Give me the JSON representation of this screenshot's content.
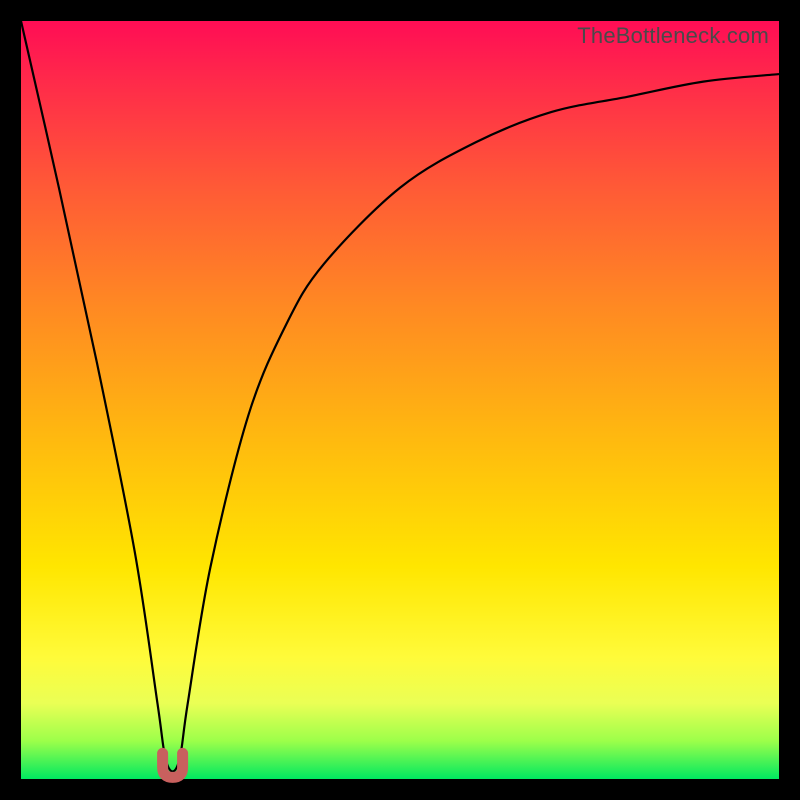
{
  "watermark": "TheBottleneck.com",
  "colors": {
    "background": "#000000",
    "gradient_top": "#ff0d55",
    "gradient_mid1": "#ff8a22",
    "gradient_mid2": "#ffe600",
    "gradient_bottom": "#00e860",
    "curve": "#000000",
    "dip_marker": "#c8605e"
  },
  "chart_data": {
    "type": "line",
    "title": "",
    "xlabel": "",
    "ylabel": "",
    "xlim": [
      0,
      100
    ],
    "ylim": [
      0,
      100
    ],
    "series": [
      {
        "name": "bottleneck-curve",
        "x": [
          0,
          5,
          10,
          15,
          18,
          19,
          20,
          21,
          22,
          25,
          30,
          35,
          40,
          50,
          60,
          70,
          80,
          90,
          100
        ],
        "y": [
          100,
          78,
          55,
          30,
          10,
          3,
          1,
          3,
          10,
          28,
          48,
          60,
          68,
          78,
          84,
          88,
          90,
          92,
          93
        ]
      }
    ],
    "annotations": [
      {
        "name": "dip-marker",
        "x": 20,
        "y": 1,
        "shape": "u"
      }
    ],
    "grid": false,
    "legend": false
  }
}
